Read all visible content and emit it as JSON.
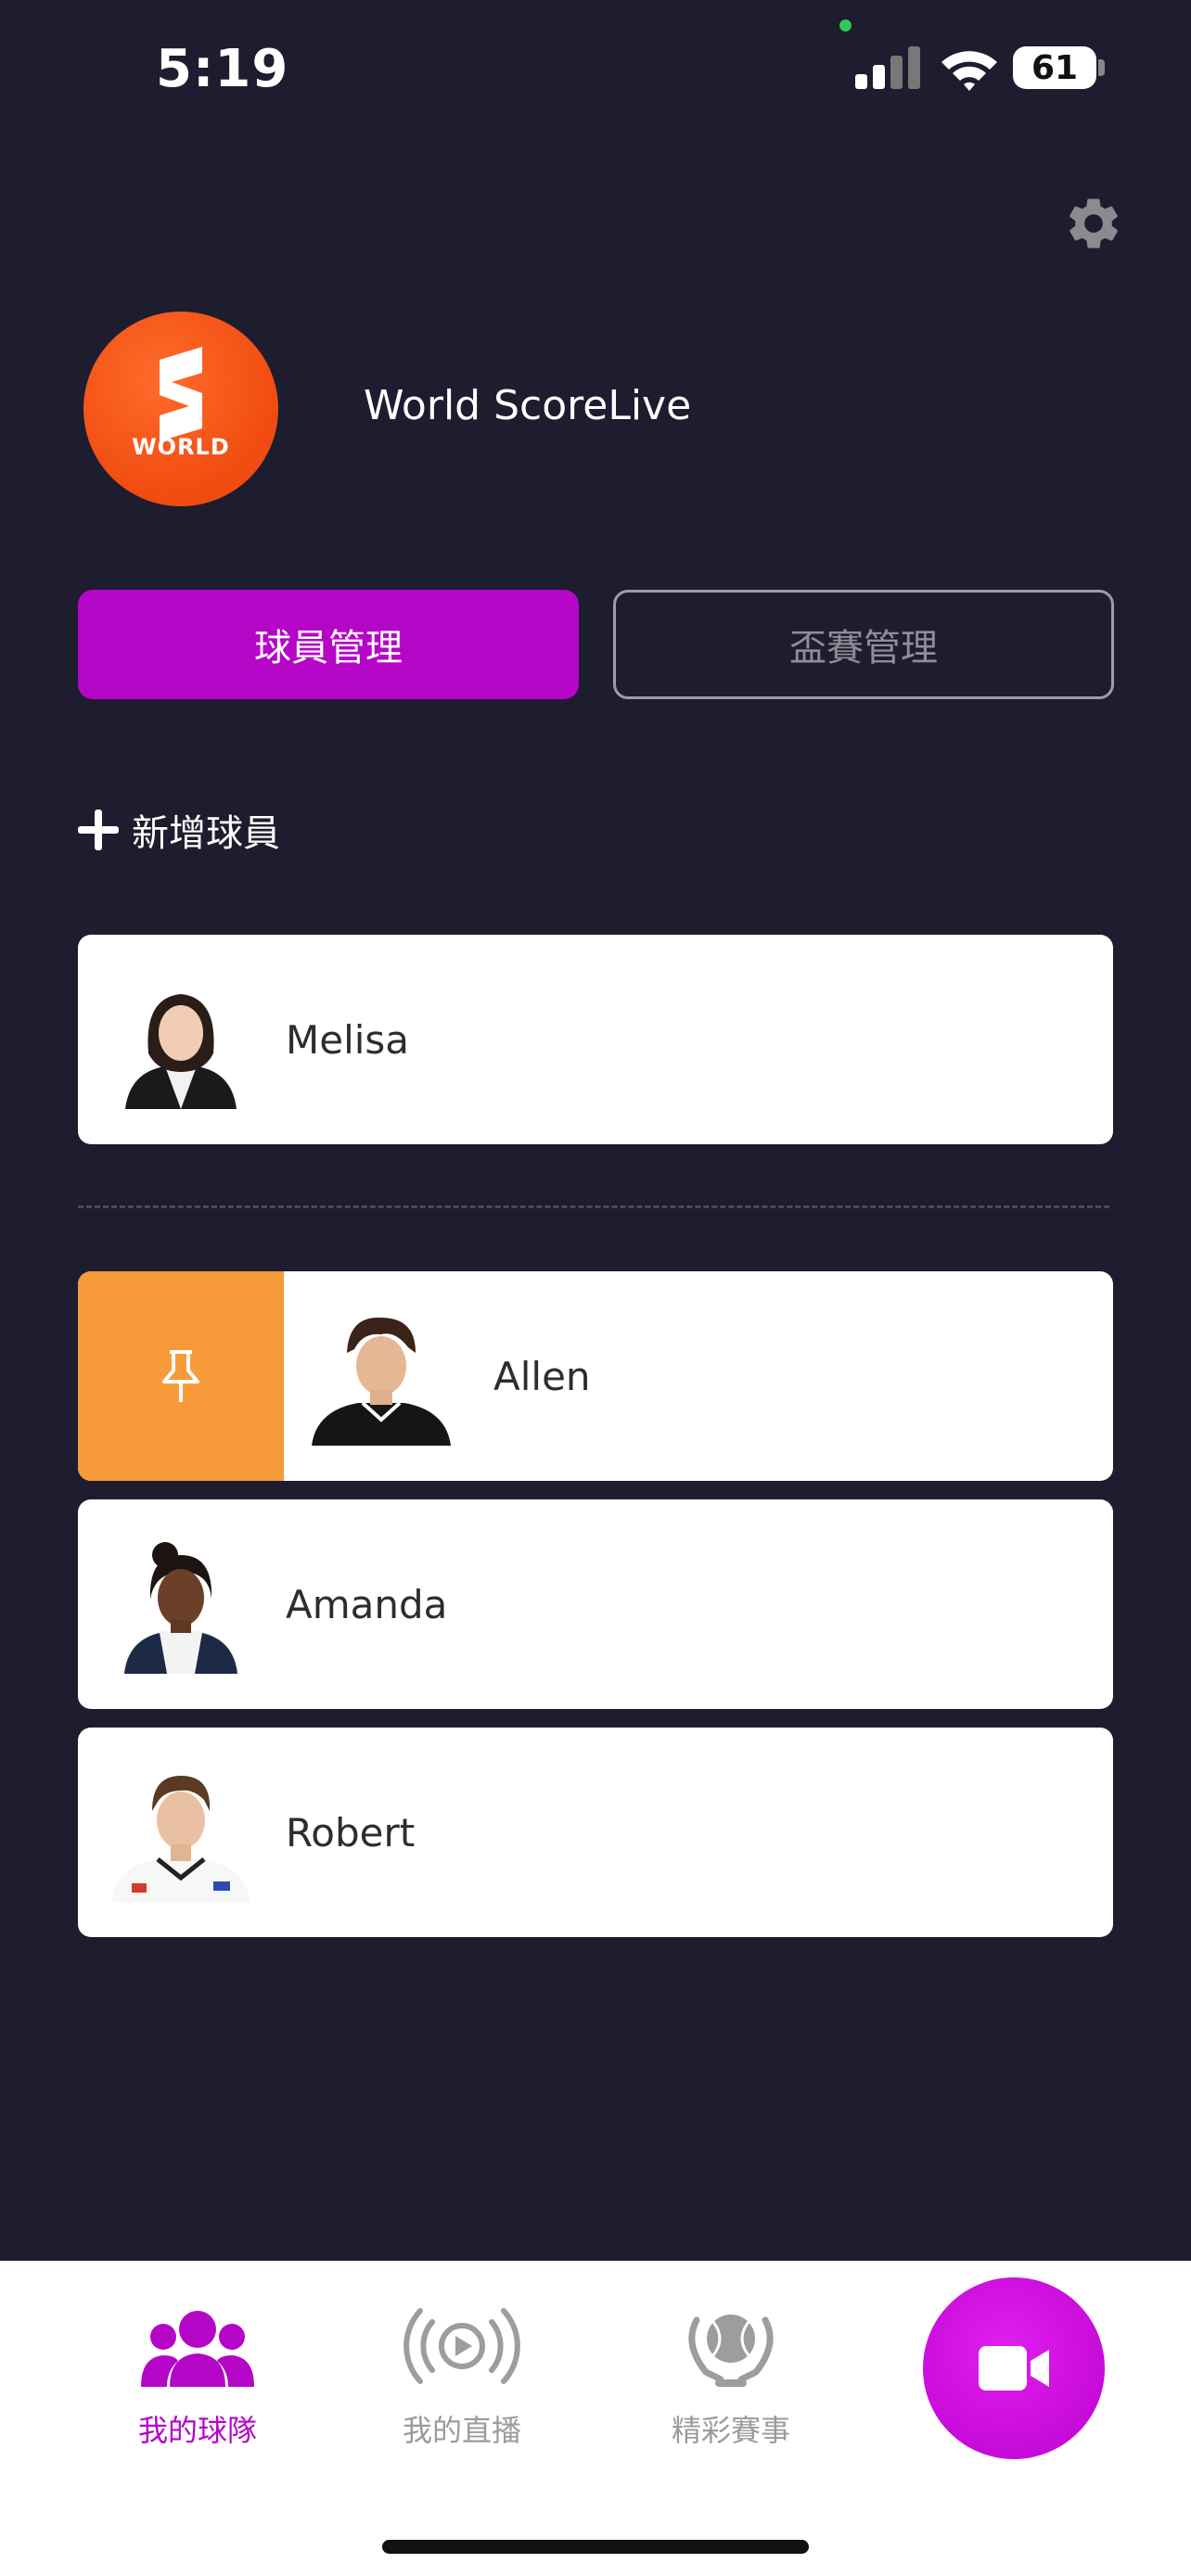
{
  "status_bar": {
    "time": "5:19",
    "battery": "61"
  },
  "profile": {
    "logo_text": "WORLD",
    "name": "World ScoreLive"
  },
  "tabs": [
    {
      "label": "球員管理",
      "active": true
    },
    {
      "label": "盃賽管理",
      "active": false
    }
  ],
  "add_player": {
    "label": "新增球員"
  },
  "players": {
    "featured": {
      "name": "Melisa"
    },
    "list": [
      {
        "name": "Allen",
        "pinned": true
      },
      {
        "name": "Amanda",
        "pinned": false
      },
      {
        "name": "Robert",
        "pinned": false
      }
    ]
  },
  "bottom_nav": {
    "items": [
      {
        "label": "我的球隊",
        "icon": "team-icon",
        "active": true
      },
      {
        "label": "我的直播",
        "icon": "live-broadcast-icon",
        "active": false
      },
      {
        "label": "精彩賽事",
        "icon": "highlight-matches-icon",
        "active": false
      }
    ],
    "fab_icon": "video-camera-icon"
  },
  "colors": {
    "background": "#1d1d2f",
    "accent": "#b506c8",
    "pin": "#f79a3a",
    "logo": "#f04b10"
  }
}
